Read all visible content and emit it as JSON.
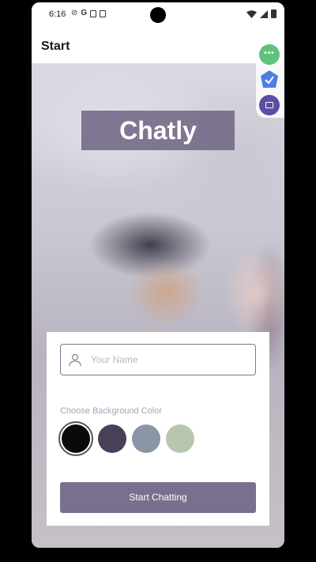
{
  "status_bar": {
    "time": "6:16",
    "icons": [
      "do-not-disturb-icon",
      "google-icon",
      "sd-card-icon",
      "notification-box-icon",
      "wifi-icon",
      "signal-icon",
      "battery-icon"
    ]
  },
  "app_bar": {
    "title": "Start"
  },
  "hero": {
    "title": "Chatly"
  },
  "side_tools": [
    "more-icon",
    "check-badge-icon",
    "chat-icon"
  ],
  "form": {
    "name_placeholder": "Your Name",
    "name_value": "",
    "color_label": "Choose Background Color",
    "colors": [
      "#090A0B",
      "#474056",
      "#8A95A5",
      "#B9C6AE"
    ],
    "selected_color_index": 0,
    "start_button_label": "Start Chatting"
  },
  "theme": {
    "accent": "#757083",
    "fab_green": "#5FC27A",
    "fab_blue": "#4D7FE0",
    "fab_purple": "#5A4EA5"
  }
}
